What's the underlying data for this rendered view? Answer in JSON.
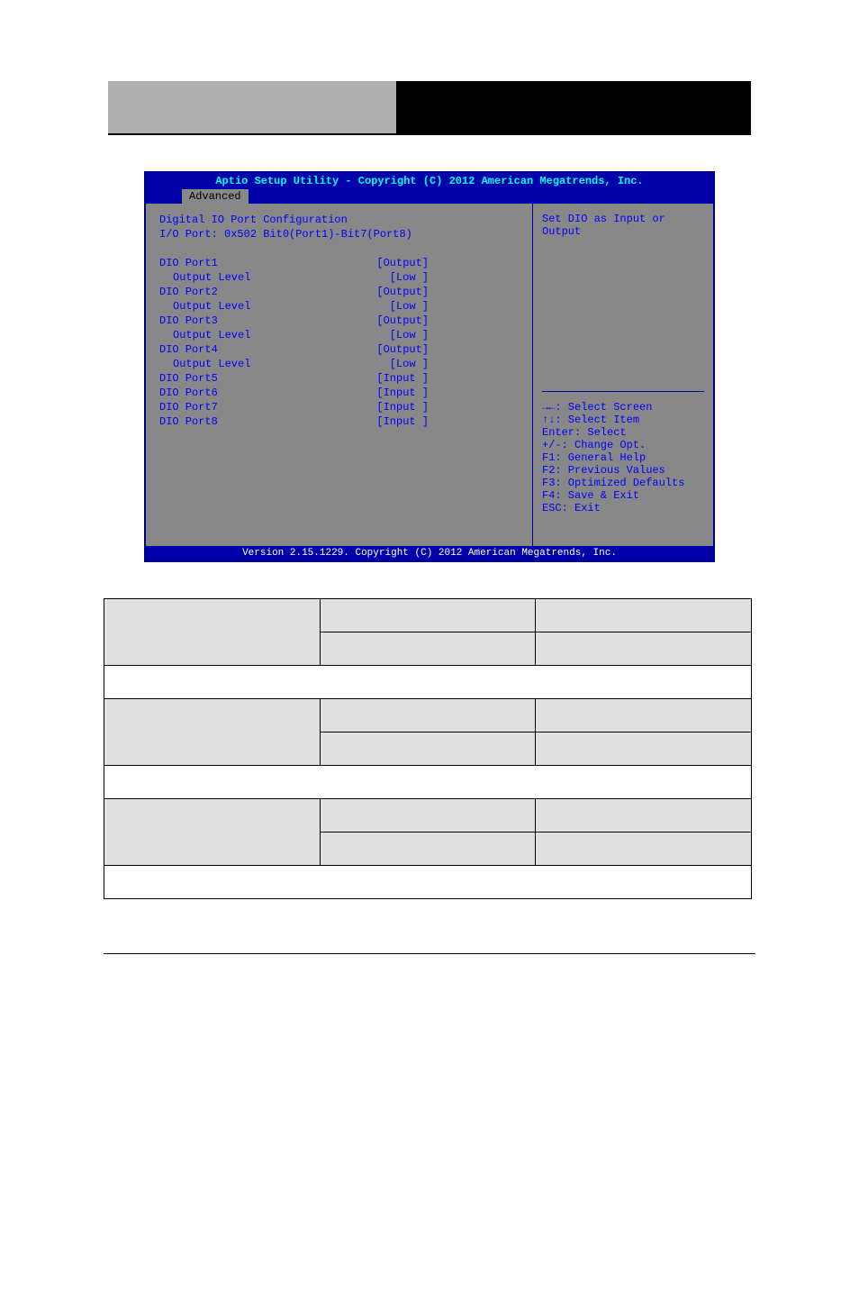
{
  "bios": {
    "title": "Aptio Setup Utility - Copyright (C) 2012 American Megatrends, Inc.",
    "tab": "Advanced",
    "heading1": "Digital IO Port Configuration",
    "heading2": "I/O Port: 0x502 Bit0(Port1)-Bit7(Port8)",
    "rows": [
      {
        "label": "DIO Port1",
        "value": "[Output]",
        "indent": false
      },
      {
        "label": "Output Level",
        "value": "[Low  ]",
        "indent": true
      },
      {
        "label": "DIO Port2",
        "value": "[Output]",
        "indent": false
      },
      {
        "label": "Output Level",
        "value": "[Low  ]",
        "indent": true
      },
      {
        "label": "DIO Port3",
        "value": "[Output]",
        "indent": false
      },
      {
        "label": "Output Level",
        "value": "[Low  ]",
        "indent": true
      },
      {
        "label": "DIO Port4",
        "value": "[Output]",
        "indent": false
      },
      {
        "label": "Output Level",
        "value": "[Low  ]",
        "indent": true
      },
      {
        "label": "DIO Port5",
        "value": "[Input ]",
        "indent": false
      },
      {
        "label": "DIO Port6",
        "value": "[Input ]",
        "indent": false
      },
      {
        "label": "DIO Port7",
        "value": "[Input ]",
        "indent": false
      },
      {
        "label": "DIO Port8",
        "value": "[Input ]",
        "indent": false
      }
    ],
    "help_top": "Set DIO as Input or Output",
    "help_keys": [
      "→←: Select Screen",
      "↑↓: Select Item",
      "Enter: Select",
      "+/-: Change Opt.",
      "F1: General Help",
      "F2: Previous Values",
      "F3: Optimized Defaults",
      "F4: Save & Exit",
      "ESC: Exit"
    ],
    "footer": "Version 2.15.1229. Copyright (C) 2012 American Megatrends, Inc."
  }
}
